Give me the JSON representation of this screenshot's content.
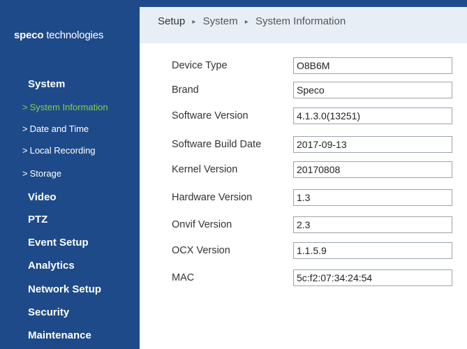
{
  "logo": {
    "bold": "speco",
    "rest": " technologies"
  },
  "sidebar": {
    "system": {
      "label": "System",
      "items": [
        {
          "label": "System Information",
          "active": true
        },
        {
          "label": "Date and Time",
          "active": false
        },
        {
          "label": "Local Recording",
          "active": false
        },
        {
          "label": "Storage",
          "active": false
        }
      ]
    },
    "sections": [
      "Video",
      "PTZ",
      "Event Setup",
      "Analytics",
      "Network Setup",
      "Security",
      "Maintenance"
    ]
  },
  "breadcrumb": {
    "items": [
      "Setup",
      "System",
      "System Information"
    ],
    "separator": "▸"
  },
  "system_info": [
    {
      "label": "Device Type",
      "value": "O8B6M"
    },
    {
      "label": "Brand",
      "value": "Speco"
    },
    {
      "label": "Software Version",
      "value": "4.1.3.0(13251)"
    },
    {
      "label": "Software Build Date",
      "value": "2017-09-13"
    },
    {
      "label": "Kernel Version",
      "value": "20170808"
    },
    {
      "label": "Hardware Version",
      "value": "1.3"
    },
    {
      "label": "Onvif Version",
      "value": "2.3"
    },
    {
      "label": "OCX Version",
      "value": "1.1.5.9"
    },
    {
      "label": "MAC",
      "value": "5c:f2:07:34:24:54"
    }
  ],
  "colors": {
    "sidebar_bg": "#1f4a89",
    "active_item": "#7fd24a",
    "topbar_bg": "#e8eef6"
  }
}
